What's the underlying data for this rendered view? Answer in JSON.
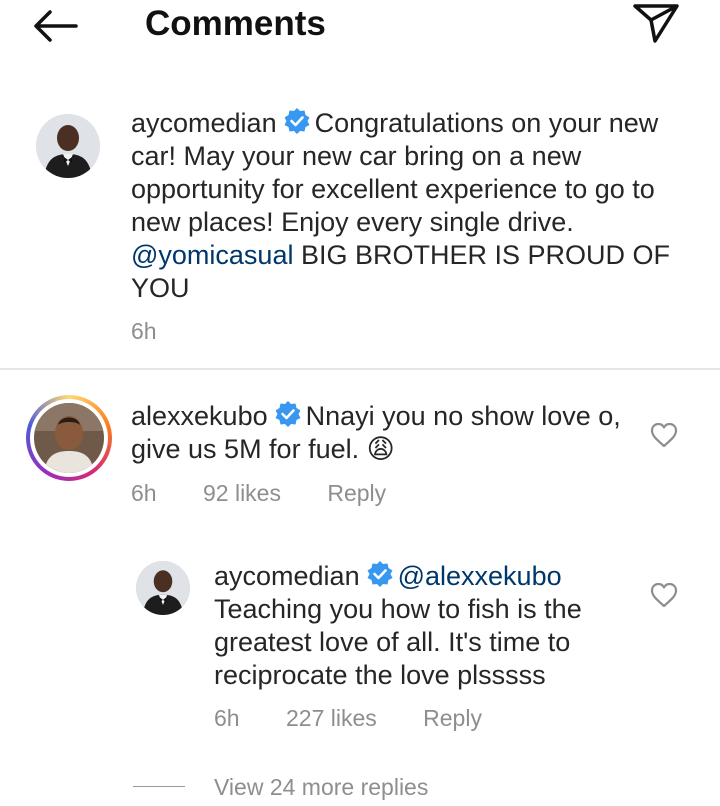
{
  "header": {
    "title": "Comments"
  },
  "comments": [
    {
      "username": "aycomedian",
      "text_plain": "Congratulations on your new car! May your new car bring on a new opportunity for excellent experience to go to new places! Enjoy every single drive. ",
      "mention": "@yomicasual",
      "text_after": " BIG BROTHER IS PROUD OF YOU",
      "time": "6h"
    },
    {
      "username": "alexxekubo",
      "text_plain": "Nnayi you no show love o, give us 5M for fuel. ",
      "emoji": "😩",
      "time": "6h",
      "likes": "92 likes",
      "reply": "Reply"
    }
  ],
  "reply": {
    "username": "aycomedian",
    "mention": "@alexxekubo",
    "text": "Teaching you how to fish is the greatest love of all. It's time to reciprocate the love plsssss",
    "time": "6h",
    "likes": "227 likes",
    "reply": "Reply"
  },
  "view_more": "View 24 more replies",
  "colors": {
    "verified": "#3897f0",
    "mention": "#00376b",
    "meta": "#8e8e8e"
  }
}
